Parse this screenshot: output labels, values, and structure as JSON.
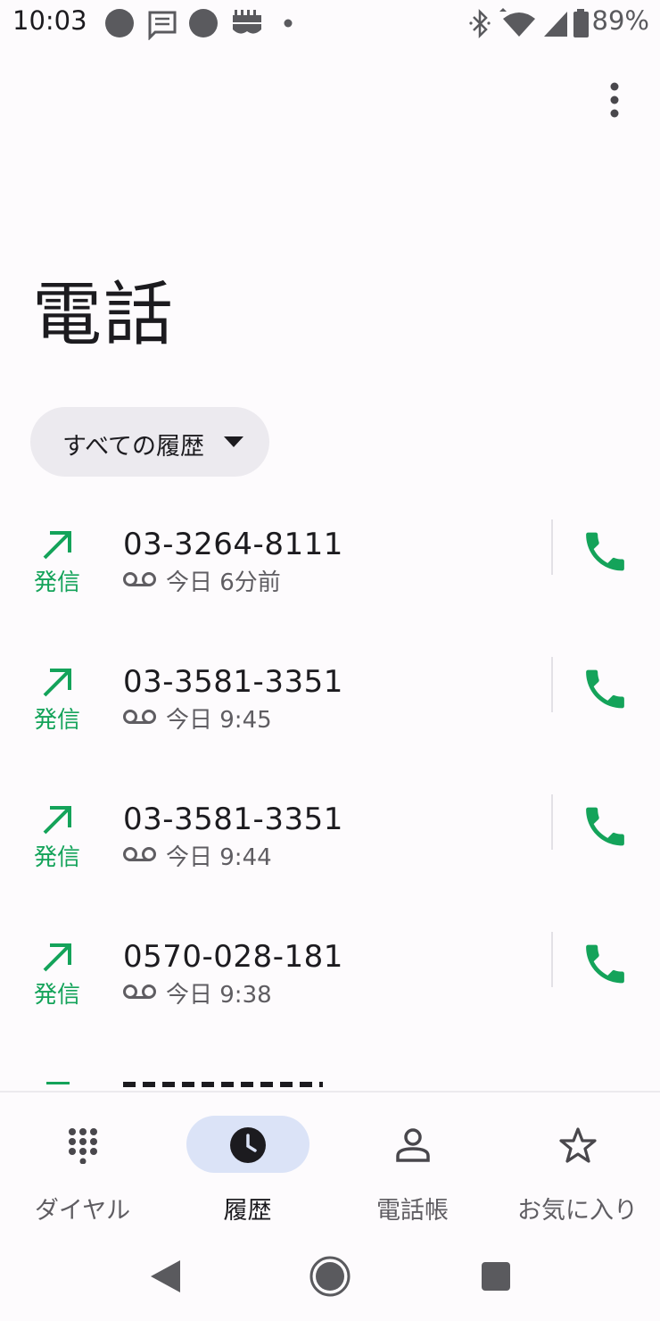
{
  "status_bar": {
    "time": "10:03",
    "battery": "89%",
    "icons": [
      "notification-dot-icon",
      "message-icon",
      "notification-dot-icon",
      "app-icon",
      "small-dot-icon",
      "bluetooth-icon",
      "wifi-icon",
      "signal-icon",
      "battery-icon"
    ]
  },
  "header": {
    "title": "電話",
    "menu_icon": "more-vert-icon"
  },
  "filter": {
    "label": "すべての履歴",
    "icon": "dropdown-caret-icon"
  },
  "calls": [
    {
      "direction_label": "発信",
      "number": "03-3264-8111",
      "time": "今日 6分前"
    },
    {
      "direction_label": "発信",
      "number": "03-3581-3351",
      "time": "今日 9:45"
    },
    {
      "direction_label": "発信",
      "number": "03-3581-3351",
      "time": "今日 9:44"
    },
    {
      "direction_label": "発信",
      "number": "0570-028-181",
      "time": "今日 9:38"
    }
  ],
  "bottom_nav": {
    "items": [
      {
        "label": "ダイヤル",
        "icon": "dialpad-icon"
      },
      {
        "label": "履歴",
        "icon": "clock-icon",
        "active": true
      },
      {
        "label": "電話帳",
        "icon": "contacts-icon"
      },
      {
        "label": "お気に入り",
        "icon": "star-icon"
      }
    ]
  },
  "colors": {
    "accent_green": "#14a35a",
    "active_pill": "#dbe3f7",
    "background": "#fdfbfd"
  }
}
